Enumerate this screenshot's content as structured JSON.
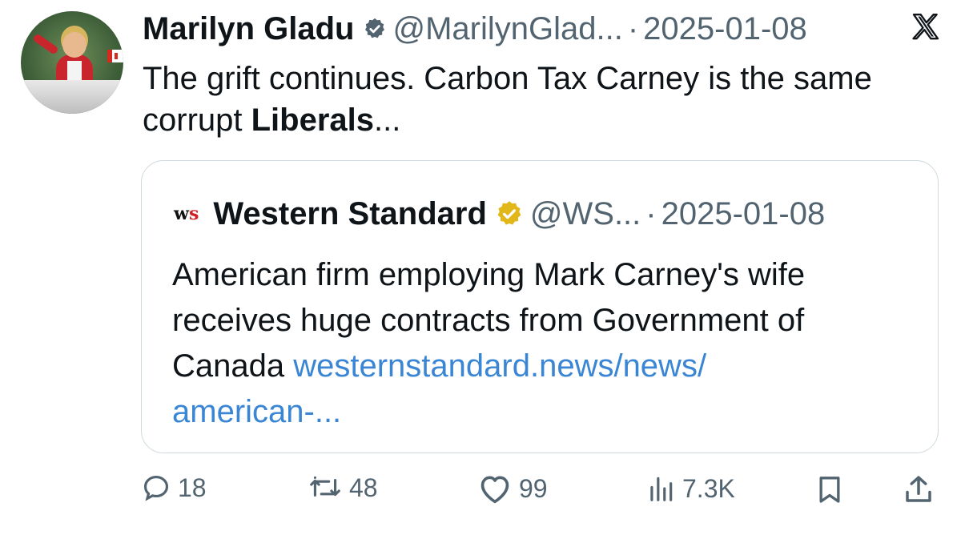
{
  "tweet": {
    "author_name": "Marilyn Gladu",
    "handle": "@MarilynGlad...",
    "separator": "·",
    "date": "2025-01-08",
    "text_lines": [
      "The grift continues. Carbon Tax Carney is the same",
      "corrupt "
    ],
    "text_bold": "Liberals",
    "text_tail": "..."
  },
  "quote": {
    "logo_text_w": "w",
    "logo_text_s": "s",
    "author_name": "Western Standard",
    "handle": "@WS...",
    "separator": "·",
    "date": "2025-01-08",
    "text_lines": [
      "American firm employing Mark Carney's wife",
      "receives huge contracts from Government of",
      "Canada "
    ],
    "link_line1": "westernstandard.news/news/",
    "link_line2": "american-..."
  },
  "actions": {
    "replies": "18",
    "reposts": "48",
    "likes": "99",
    "views": "7.3K"
  },
  "icons": {
    "verified_blue": "verified-badge-icon",
    "verified_gold": "gold-verified-badge-icon",
    "x_logo": "x-logo-icon",
    "reply": "reply-icon",
    "repost": "repost-icon",
    "like": "heart-icon",
    "views": "views-chart-icon",
    "bookmark": "bookmark-icon",
    "share": "share-icon"
  },
  "colors": {
    "text": "#0f1419",
    "muted": "#536471",
    "link": "#3a86d4",
    "border": "#cfd9de"
  }
}
